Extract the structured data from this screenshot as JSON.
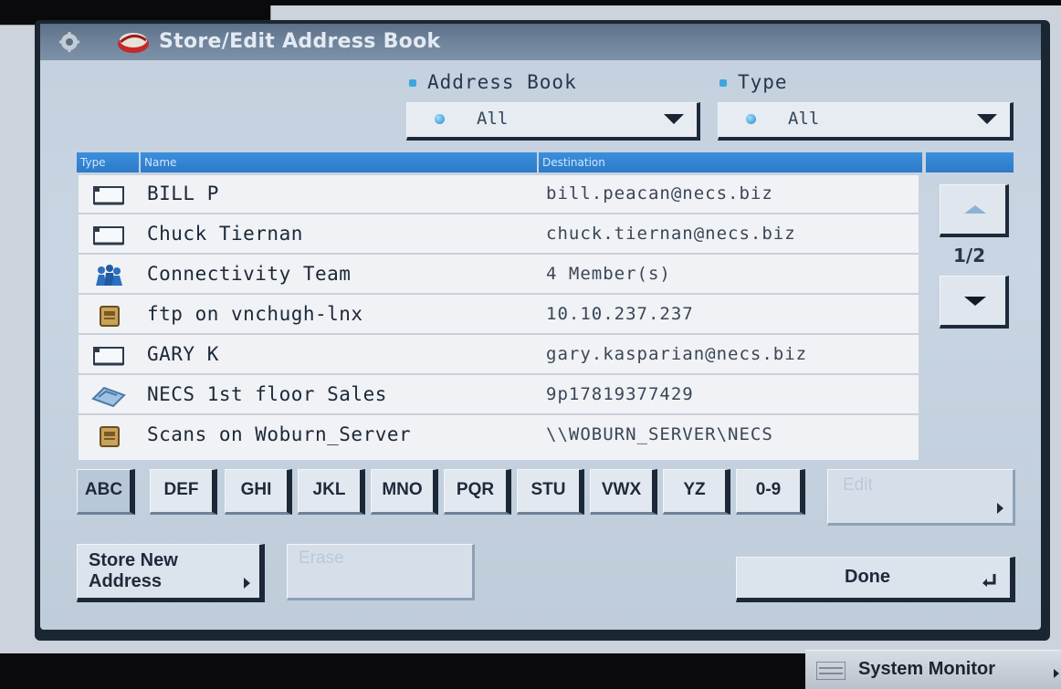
{
  "window": {
    "title": "Store/Edit Address Book"
  },
  "filters": {
    "address_book": {
      "label": "Address Book",
      "value": "All"
    },
    "type": {
      "label": "Type",
      "value": "All"
    }
  },
  "list": {
    "columns": [
      "Type",
      "Name",
      "Destination"
    ],
    "rows": [
      {
        "icon": "email-icon",
        "name": "BILL P",
        "destination": "bill.peacan@necs.biz"
      },
      {
        "icon": "email-icon",
        "name": "Chuck Tiernan",
        "destination": "chuck.tiernan@necs.biz"
      },
      {
        "icon": "group-icon",
        "name": "Connectivity Team",
        "destination": "4 Member(s)"
      },
      {
        "icon": "file-server-icon",
        "name": "ftp on vnchugh-lnx",
        "destination": "10.10.237.237"
      },
      {
        "icon": "email-icon",
        "name": "GARY K",
        "destination": "gary.kasparian@necs.biz"
      },
      {
        "icon": "fax-icon",
        "name": "NECS 1st floor Sales",
        "destination": "9p17819377429"
      },
      {
        "icon": "file-server-icon",
        "name": "Scans on Woburn_Server",
        "destination": "\\\\WOBURN_SERVER\\NECS"
      }
    ]
  },
  "pagination": {
    "indicator": "1/2"
  },
  "index_tabs": [
    "ABC",
    "DEF",
    "GHI",
    "JKL",
    "MNO",
    "PQR",
    "STU",
    "VWX",
    "YZ",
    "0-9"
  ],
  "buttons": {
    "edit": "Edit",
    "store_new_line1": "Store New",
    "store_new_line2": "Address",
    "erase": "Erase",
    "done": "Done"
  },
  "system_monitor": {
    "label": "System Monitor"
  }
}
